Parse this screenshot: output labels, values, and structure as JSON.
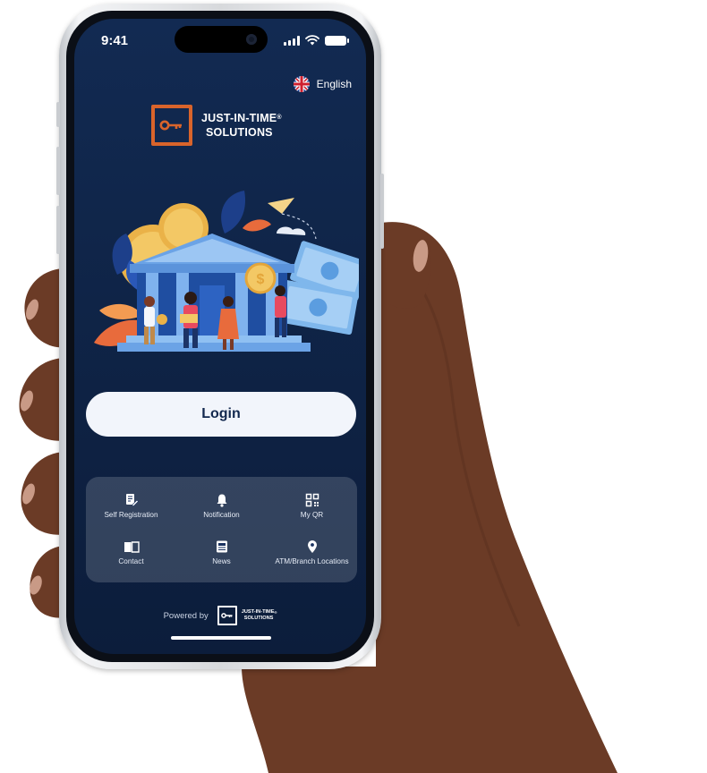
{
  "status_bar": {
    "time": "9:41"
  },
  "language": {
    "label": "English",
    "flag_icon": "uk-flag-icon"
  },
  "brand": {
    "line1": "JUST-IN-TIME",
    "line2": "SOLUTIONS",
    "registered": "®",
    "logo_icon": "key-icon",
    "accent_color": "#d9642b"
  },
  "login": {
    "label": "Login"
  },
  "quick_actions": [
    {
      "label": "Self Registration",
      "icon": "edit-document-icon"
    },
    {
      "label": "Notification",
      "icon": "bell-icon"
    },
    {
      "label": "My QR",
      "icon": "qr-code-icon"
    },
    {
      "label": "Contact",
      "icon": "book-icon"
    },
    {
      "label": "News",
      "icon": "newspaper-icon"
    },
    {
      "label": "ATM/Branch Locations",
      "icon": "location-pin-icon"
    }
  ],
  "footer": {
    "powered_by": "Powered by",
    "logo_line1": "JUST-IN-TIME",
    "logo_line2": "SOLUTIONS",
    "registered": "®"
  },
  "colors": {
    "screen_background": "#122a52",
    "button_background": "#f2f5fb",
    "button_text": "#12284e"
  }
}
